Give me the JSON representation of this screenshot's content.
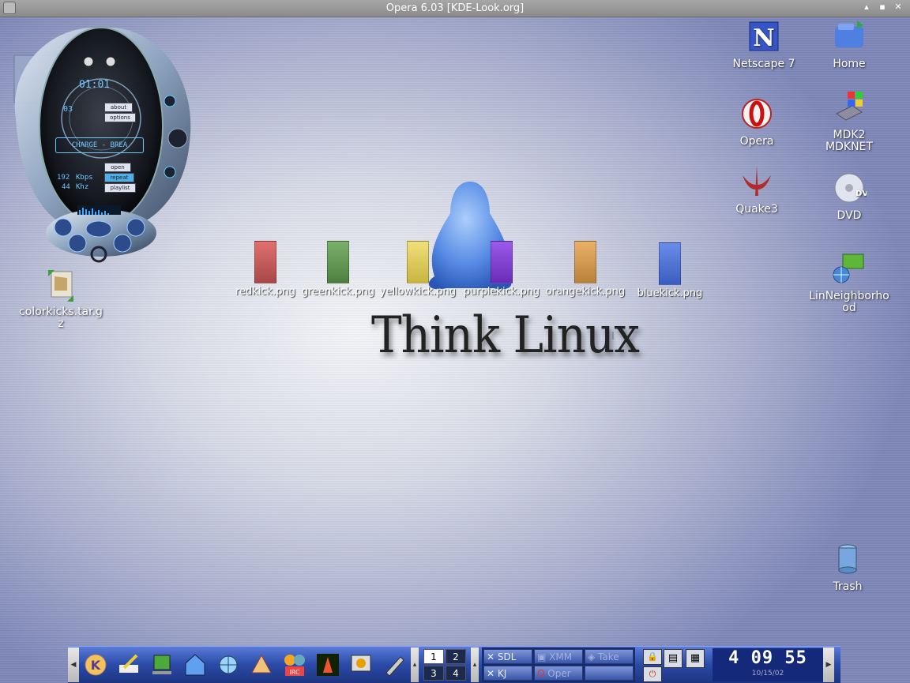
{
  "window": {
    "title": "Opera 6.03  [KDE-Look.org]"
  },
  "desktop": {
    "logo_text": "Think Linux",
    "icons_right": [
      {
        "label": "Netscape 7",
        "icon": "netscape-icon"
      },
      {
        "label": "Home",
        "icon": "home-folder-icon"
      },
      {
        "label": "Opera",
        "icon": "opera-icon"
      },
      {
        "label": "MDK2\nMDKNET",
        "icon": "network-cd-icon"
      },
      {
        "label": "Quake3",
        "icon": "quake3-icon"
      },
      {
        "label": "DVD",
        "icon": "dvd-icon"
      },
      {
        "label": "LinNeighborhood",
        "icon": "network-neighborhood-icon"
      },
      {
        "label": "Trash",
        "icon": "trash-icon"
      }
    ],
    "archive": {
      "label": "colorkicks.tar.gz",
      "icon": "archive-icon"
    },
    "kicks": [
      {
        "label": "redkick.png",
        "color": "#d85f5f"
      },
      {
        "label": "greenkick.png",
        "color": "#6aa25a"
      },
      {
        "label": "yellowkick.png",
        "color": "#e3d35a"
      },
      {
        "label": "purplekick.png",
        "color": "#8a45d6"
      },
      {
        "label": "orangekick.png",
        "color": "#e0a55a"
      },
      {
        "label": "bluekick.png",
        "color": "#5077d6"
      }
    ]
  },
  "player": {
    "time": "01:01",
    "track_no": "03",
    "track_title": "CHARGE - BREA",
    "bitrate": "192",
    "bitrate_unit": "Kbps",
    "khz": "44",
    "khz_unit": "Khz",
    "buttons": [
      "about",
      "options",
      "open",
      "repeat",
      "playlist"
    ]
  },
  "taskbar": {
    "pager": [
      "1",
      "2",
      "3",
      "4"
    ],
    "tasks": [
      "SDL",
      "XMM",
      "Take",
      "KJ",
      "Oper",
      ""
    ],
    "clock_time": "4 09 55",
    "clock_date": "10/15/02"
  }
}
